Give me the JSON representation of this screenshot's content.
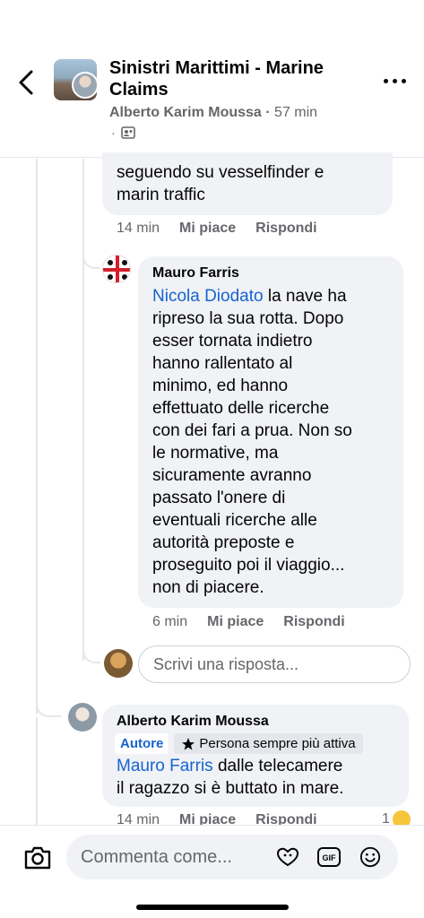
{
  "header": {
    "title": "Sinistri Marittimi - Marine Claims",
    "author": "Alberto Karim Moussa",
    "time": "57 min",
    "privacy_icon": "members-icon"
  },
  "comments": [
    {
      "partial_text_line1": "seguendo su vesselfinder e",
      "partial_text_line2": "marin traffic",
      "time": "14 min",
      "like_label": "Mi piace",
      "reply_label": "Rispondi"
    },
    {
      "author": "Mauro Farris",
      "mention": "Nicola Diodato",
      "text_after_mention": " la nave ha",
      "lines": [
        "ripreso la sua rotta. Dopo",
        "esser tornata indietro",
        "hanno rallentato al",
        "minimo,  ed hanno",
        "effettuato delle ricerche",
        "con dei fari a prua. Non so",
        "le normative, ma",
        "sicuramente avranno",
        "passato l'onere di",
        "eventuali ricerche alle",
        "autorità preposte e",
        "proseguito poi il viaggio...",
        "non di piacere."
      ],
      "time": "6 min",
      "like_label": "Mi piace",
      "reply_label": "Rispondi"
    },
    {
      "author": "Alberto Karim Moussa",
      "badge_author": "Autore",
      "badge_active": "Persona sempre più attiva",
      "mention": "Mauro Farris",
      "text_after_mention": " dalle telecamere",
      "line2": "il ragazzo si è buttato in mare.",
      "time": "14 min",
      "like_label": "Mi piace",
      "reply_label": "Rispondi",
      "reaction_count": "1"
    }
  ],
  "reply_input": {
    "placeholder": "Scrivi una risposta..."
  },
  "composer": {
    "placeholder": "Commenta come..."
  },
  "colors": {
    "accent": "#1763cf",
    "bubble": "#f0f2f5",
    "muted": "#65676b"
  }
}
